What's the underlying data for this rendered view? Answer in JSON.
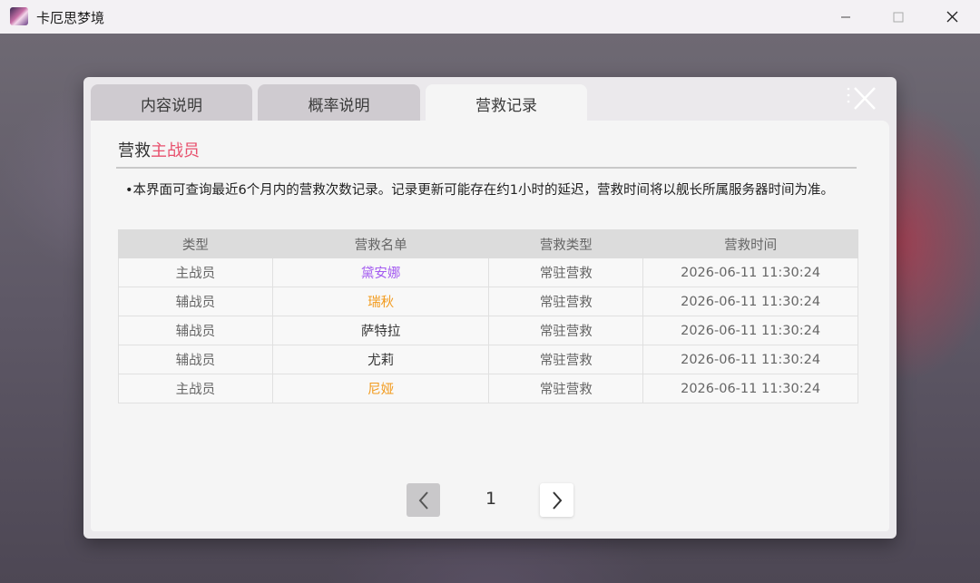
{
  "window": {
    "title": "卡厄思梦境",
    "app_icon": "app-icon"
  },
  "tabs": [
    {
      "label": "内容说明",
      "active": false
    },
    {
      "label": "概率说明",
      "active": false
    },
    {
      "label": "营救记录",
      "active": true
    }
  ],
  "section": {
    "title_prefix": "营救",
    "title_highlight": "主战员",
    "accent_color": "#e8506d"
  },
  "notice": "•本界面可查询最近6个月内的营救次数记录。记录更新可能存在约1小时的延迟，营救时间将以舰长所属服务器时间为准。",
  "table": {
    "headers": [
      "类型",
      "营救名单",
      "营救类型",
      "营救时间"
    ],
    "rows": [
      {
        "type": "主战员",
        "name": "黛安娜",
        "name_color": "#a45cf0",
        "rescue_type": "常驻营救",
        "time": "2026-06-11 11:30:24"
      },
      {
        "type": "辅战员",
        "name": "瑞秋",
        "name_color": "#f29a1c",
        "rescue_type": "常驻营救",
        "time": "2026-06-11 11:30:24"
      },
      {
        "type": "辅战员",
        "name": "萨特拉",
        "name_color": "#333333",
        "rescue_type": "常驻营救",
        "time": "2026-06-11 11:30:24"
      },
      {
        "type": "辅战员",
        "name": "尤莉",
        "name_color": "#333333",
        "rescue_type": "常驻营救",
        "time": "2026-06-11 11:30:24"
      },
      {
        "type": "主战员",
        "name": "尼娅",
        "name_color": "#f29a1c",
        "rescue_type": "常驻营救",
        "time": "2026-06-11 11:30:24"
      }
    ]
  },
  "pagination": {
    "current_page": "1",
    "prev_icon": "chevron-left-icon",
    "next_icon": "chevron-right-icon"
  }
}
